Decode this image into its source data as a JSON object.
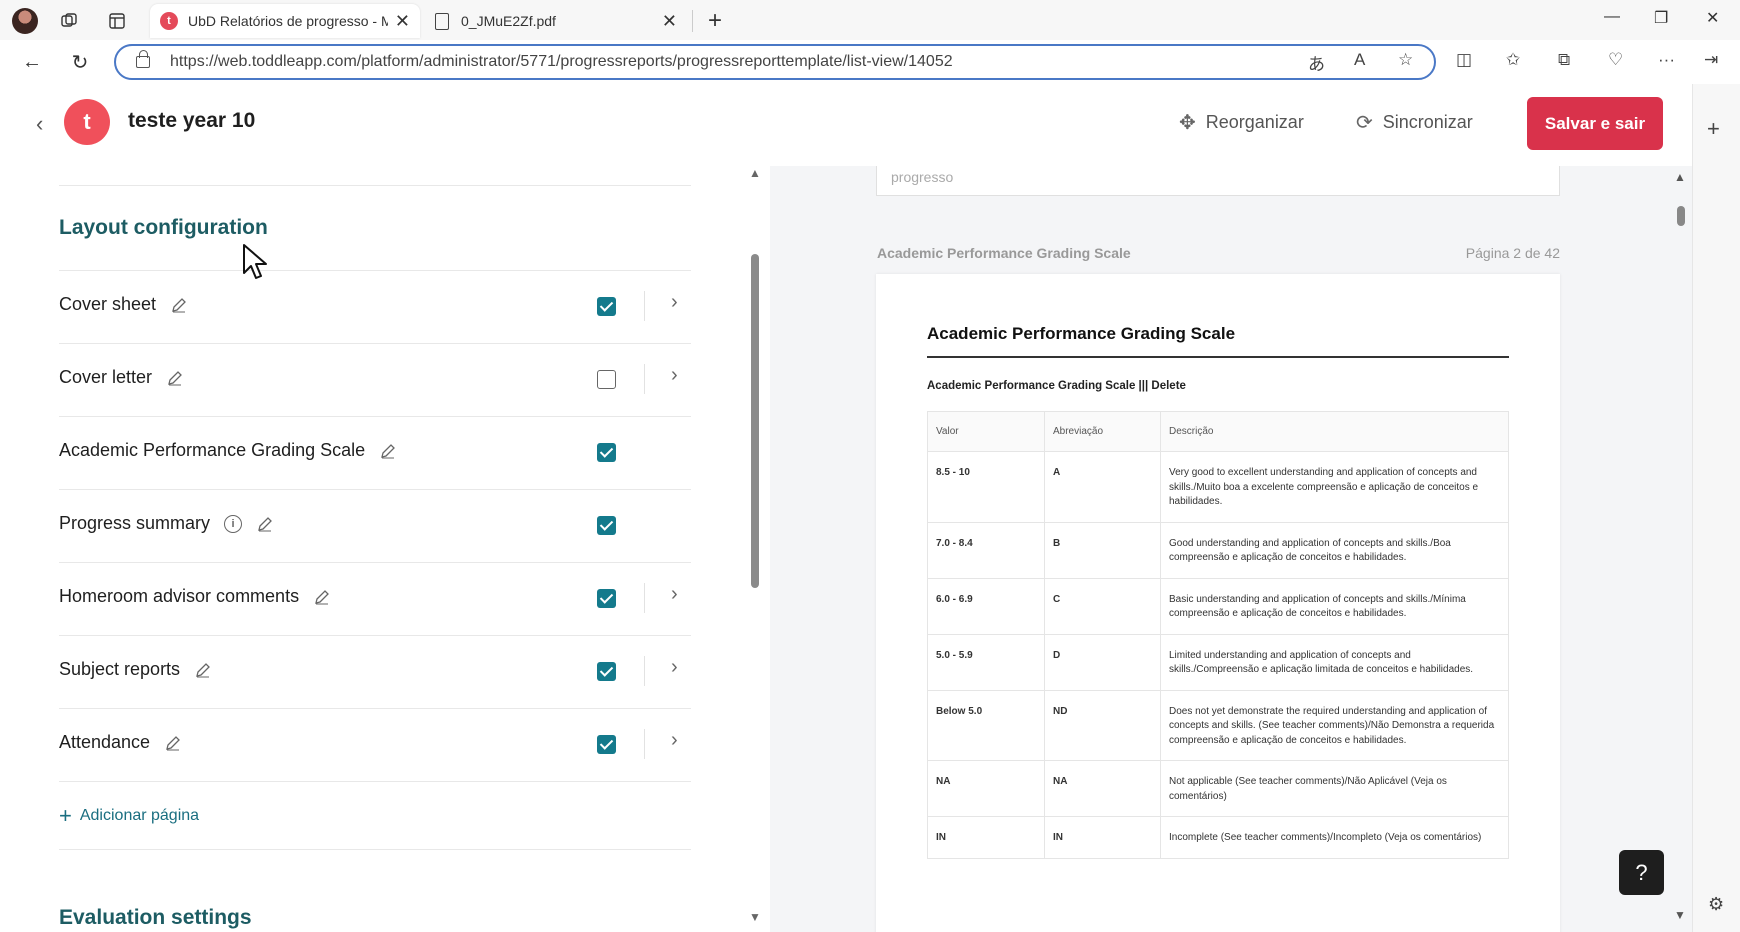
{
  "browser": {
    "tabs": [
      {
        "title": "UbD Relatórios de progresso - M",
        "active": true,
        "favicon": "toddle-icon"
      },
      {
        "title": "0_JMuE2Zf.pdf",
        "active": false,
        "favicon": "pdf-icon"
      }
    ],
    "new_tab": "+",
    "url": "https://web.toddleapp.com/platform/administrator/5771/progressreports/progressreporttemplate/list-view/14052"
  },
  "header": {
    "logo_letter": "t",
    "title": "teste year 10",
    "reorganize_label": "Reorganizar",
    "sync_label": "Sincronizar",
    "save_label": "Salvar e sair",
    "accent_color": "#d9324b"
  },
  "left_panel": {
    "section_title": "Layout configuration",
    "pages": [
      {
        "label": "Cover sheet",
        "checked": true,
        "has_info": false,
        "has_arrow": true
      },
      {
        "label": "Cover letter",
        "checked": false,
        "has_info": false,
        "has_arrow": true
      },
      {
        "label": "Academic Performance Grading Scale",
        "checked": true,
        "has_info": false,
        "has_arrow": false
      },
      {
        "label": "Progress summary",
        "checked": true,
        "has_info": true,
        "has_arrow": false
      },
      {
        "label": "Homeroom advisor comments",
        "checked": true,
        "has_info": false,
        "has_arrow": true
      },
      {
        "label": "Subject reports",
        "checked": true,
        "has_info": false,
        "has_arrow": true
      },
      {
        "label": "Attendance",
        "checked": true,
        "has_info": false,
        "has_arrow": true
      }
    ],
    "add_page_label": "Adicionar página",
    "next_section_title": "Evaluation settings",
    "checkbox_color": "#147a8c"
  },
  "preview": {
    "top_input_placeholder": "progresso",
    "page_section_title": "Academic Performance Grading Scale",
    "page_indicator": "Página 2 de 42",
    "paper_title": "Academic Performance Grading Scale",
    "table_caption": "Academic Performance Grading Scale ||| Delete",
    "table_headers": [
      "Valor",
      "Abreviação",
      "Descrição"
    ],
    "table_rows": [
      {
        "valor": "8.5 - 10",
        "abrev": "A",
        "desc": "Very good to excellent understanding and application of concepts and skills./Muito boa a excelente compreensão e aplicação de conceitos e habilidades."
      },
      {
        "valor": "7.0 - 8.4",
        "abrev": "B",
        "desc": "Good understanding and application of concepts and skills./Boa compreensão e aplicação de conceitos e habilidades."
      },
      {
        "valor": "6.0 - 6.9",
        "abrev": "C",
        "desc": "Basic understanding and application of concepts and skills./Mínima compreensão e aplicação de conceitos e habilidades."
      },
      {
        "valor": "5.0 - 5.9",
        "abrev": "D",
        "desc": "Limited understanding and application of concepts and skills./Compreensão e aplicação limitada de conceitos e habilidades."
      },
      {
        "valor": "Below 5.0",
        "abrev": "ND",
        "desc": "Does not yet demonstrate the required understanding and application of concepts and skills. (See teacher comments)/Não Demonstra a requerida compreensão e aplicação de conceitos e habilidades."
      },
      {
        "valor": "NA",
        "abrev": "NA",
        "desc": "Not applicable (See teacher comments)/Não Aplicável (Veja os comentários)"
      },
      {
        "valor": "IN",
        "abrev": "IN",
        "desc": "Incomplete (See teacher comments)/Incompleto (Veja os comentários)"
      }
    ],
    "help_label": "?"
  }
}
